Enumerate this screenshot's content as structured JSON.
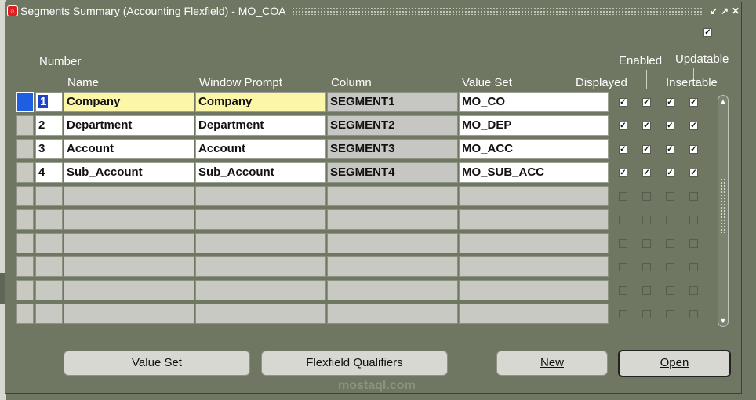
{
  "window": {
    "title": "Segments Summary (Accounting Flexfield) - MO_COA",
    "controls": [
      "↙",
      "↗",
      "✕"
    ]
  },
  "corner_checkbox": "✓",
  "headers": {
    "number": "Number",
    "name": "Name",
    "window_prompt": "Window Prompt",
    "column": "Column",
    "value_set": "Value Set",
    "displayed": "Displayed",
    "enabled": "Enabled",
    "updatable": "Updatable",
    "insertable": "Insertable"
  },
  "rows": [
    {
      "number": "1",
      "name": "Company",
      "window_prompt": "Company",
      "column": "SEGMENT1",
      "value_set": "MO_CO",
      "displayed": true,
      "enabled": true,
      "insertable": true,
      "updatable": true
    },
    {
      "number": "2",
      "name": "Department",
      "window_prompt": "Department",
      "column": "SEGMENT2",
      "value_set": "MO_DEP",
      "displayed": true,
      "enabled": true,
      "insertable": true,
      "updatable": true
    },
    {
      "number": "3",
      "name": "Account",
      "window_prompt": "Account",
      "column": "SEGMENT3",
      "value_set": "MO_ACC",
      "displayed": true,
      "enabled": true,
      "insertable": true,
      "updatable": true
    },
    {
      "number": "4",
      "name": "Sub_Account",
      "window_prompt": "Sub_Account",
      "column": "SEGMENT4",
      "value_set": "MO_SUB_ACC",
      "displayed": true,
      "enabled": true,
      "insertable": true,
      "updatable": true
    }
  ],
  "empty_rows": 6,
  "buttons": {
    "value_set": "Value Set",
    "flexfield_qualifiers": "Flexfield Qualifiers",
    "new": "New",
    "open": "Open"
  },
  "watermark": "mostaql.com",
  "icons": {
    "window": "oracle-icon",
    "scroll_up": "chevron-up-icon",
    "scroll_down": "chevron-down-icon"
  },
  "colors": {
    "background": "#6f7763",
    "selection": "#1d5fe0",
    "current_field": "#fbf6a8"
  }
}
